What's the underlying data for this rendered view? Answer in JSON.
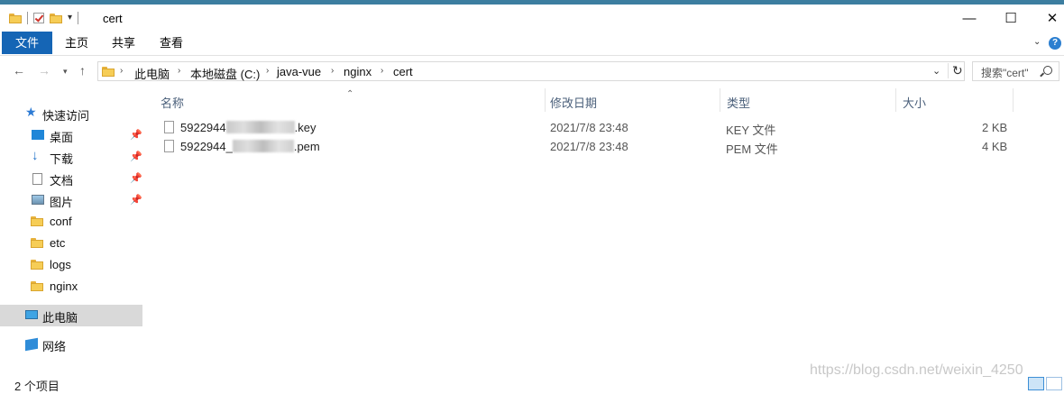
{
  "window": {
    "title": "cert"
  },
  "ribbon": {
    "tabs": [
      "文件",
      "主页",
      "共享",
      "查看"
    ]
  },
  "address": {
    "crumbs": [
      "此电脑",
      "本地磁盘 (C:)",
      "java-vue",
      "nginx",
      "cert"
    ],
    "search_placeholder": "搜索\"cert\""
  },
  "nav": {
    "quick_access": "快速访问",
    "items": [
      {
        "label": "桌面",
        "pinned": true
      },
      {
        "label": "下载",
        "pinned": true
      },
      {
        "label": "文档",
        "pinned": true
      },
      {
        "label": "图片",
        "pinned": true
      },
      {
        "label": "conf",
        "pinned": false
      },
      {
        "label": "etc",
        "pinned": false
      },
      {
        "label": "logs",
        "pinned": false
      },
      {
        "label": "nginx",
        "pinned": false
      }
    ],
    "this_pc": "此电脑",
    "network": "网络"
  },
  "columns": {
    "name": "名称",
    "date": "修改日期",
    "type": "类型",
    "size": "大小"
  },
  "files": [
    {
      "name_start": "5922944",
      "name_end": ".key",
      "date": "2021/7/8 23:48",
      "type": "KEY 文件",
      "size": "2 KB"
    },
    {
      "name_start": "5922944_",
      "name_end": ".pem",
      "date": "2021/7/8 23:48",
      "type": "PEM 文件",
      "size": "4 KB"
    }
  ],
  "status": {
    "count": "2 个项目"
  },
  "watermark": "https://blog.csdn.net/weixin_4250"
}
